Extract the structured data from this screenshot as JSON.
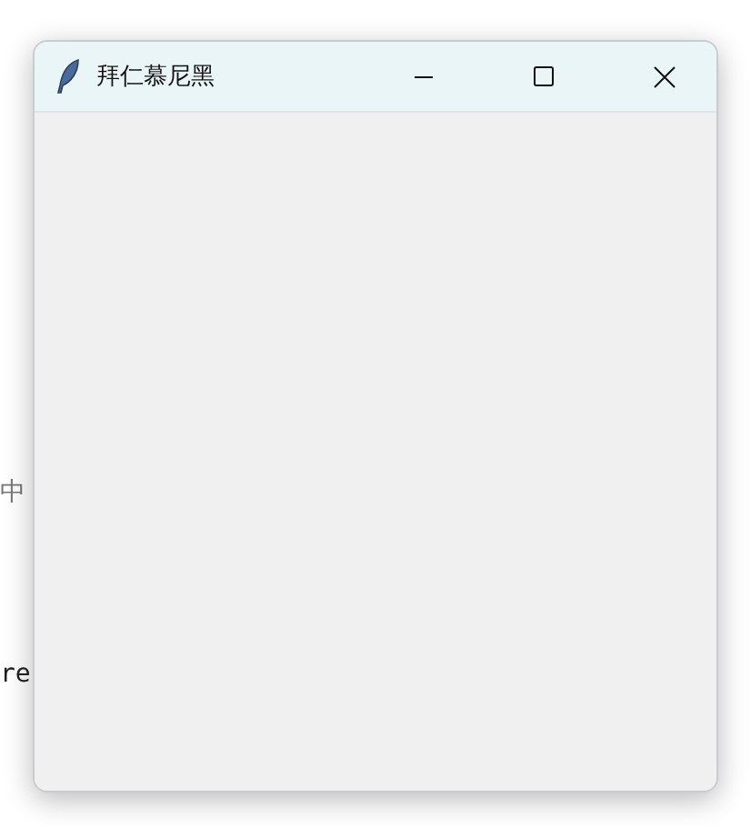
{
  "background_text": [
    "中",
    "re"
  ],
  "window": {
    "title": "拜仁慕尼黑"
  }
}
